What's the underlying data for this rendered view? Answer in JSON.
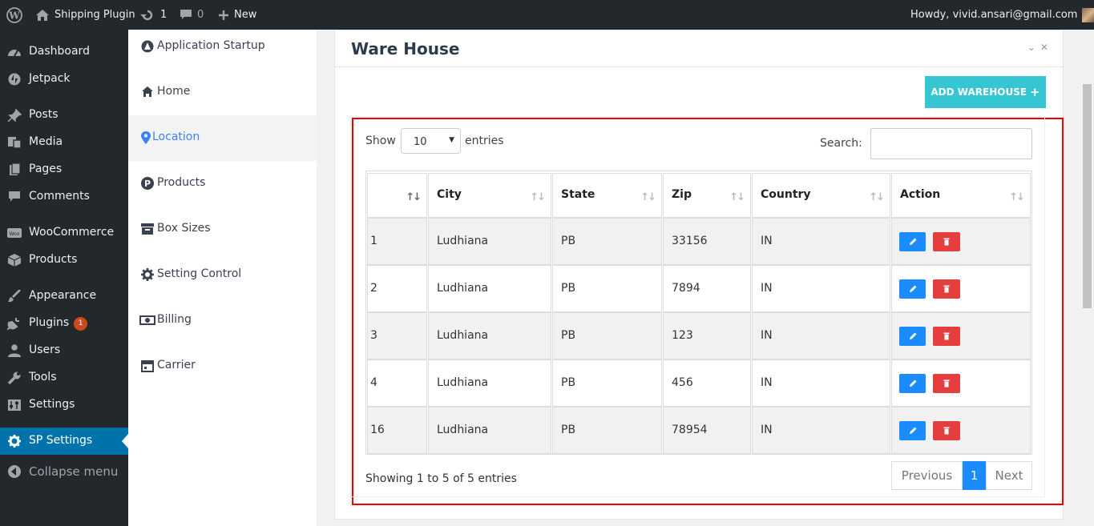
{
  "adminbar": {
    "site_name": "Shipping Plugin",
    "updates_count": "1",
    "comments_count": "0",
    "new_label": "New",
    "howdy": "Howdy, vivid.ansari@gmail.com"
  },
  "sidebar": {
    "items": [
      {
        "label": "Dashboard",
        "icon": "dashboard-icon"
      },
      {
        "label": "Jetpack",
        "icon": "jetpack-icon"
      },
      {
        "label": "Posts",
        "icon": "pin-icon"
      },
      {
        "label": "Media",
        "icon": "media-icon"
      },
      {
        "label": "Pages",
        "icon": "pages-icon"
      },
      {
        "label": "Comments",
        "icon": "comment-icon"
      },
      {
        "label": "WooCommerce",
        "icon": "woo-icon"
      },
      {
        "label": "Products",
        "icon": "box-icon"
      },
      {
        "label": "Appearance",
        "icon": "brush-icon"
      },
      {
        "label": "Plugins",
        "icon": "plug-icon",
        "badge": "1"
      },
      {
        "label": "Users",
        "icon": "user-icon"
      },
      {
        "label": "Tools",
        "icon": "wrench-icon"
      },
      {
        "label": "Settings",
        "icon": "settings-icon"
      },
      {
        "label": "SP Settings",
        "icon": "gear-icon"
      },
      {
        "label": "Collapse menu",
        "icon": "collapse-icon"
      }
    ]
  },
  "plugin_nav": {
    "items": [
      {
        "label": "Application Startup"
      },
      {
        "label": "Home"
      },
      {
        "label": "Location"
      },
      {
        "label": "Products"
      },
      {
        "label": "Box Sizes"
      },
      {
        "label": "Setting Control"
      },
      {
        "label": "Billing"
      },
      {
        "label": "Carrier"
      }
    ]
  },
  "panel": {
    "title": "Ware House",
    "add_button": "ADD WAREHOUSE"
  },
  "table": {
    "show_label": "Show",
    "entries_label": "entries",
    "page_size": "10",
    "search_label": "Search:",
    "headers": [
      "",
      "City",
      "State",
      "Zip",
      "Country",
      "Action"
    ],
    "rows": [
      [
        "1",
        "Ludhiana",
        "PB",
        "33156",
        "IN"
      ],
      [
        "2",
        "Ludhiana",
        "PB",
        "7894",
        "IN"
      ],
      [
        "3",
        "Ludhiana",
        "PB",
        "123",
        "IN"
      ],
      [
        "4",
        "Ludhiana",
        "PB",
        "456",
        "IN"
      ],
      [
        "16",
        "Ludhiana",
        "PB",
        "78954",
        "IN"
      ]
    ],
    "info": "Showing 1 to 5 of 5 entries",
    "previous": "Previous",
    "current_page": "1",
    "next": "Next"
  },
  "colors": {
    "accent": "#0073aa",
    "button_teal": "#36c6d3",
    "edit_blue": "#1a8cff",
    "delete_red": "#e53e3e",
    "highlight_border": "#ee0000"
  }
}
